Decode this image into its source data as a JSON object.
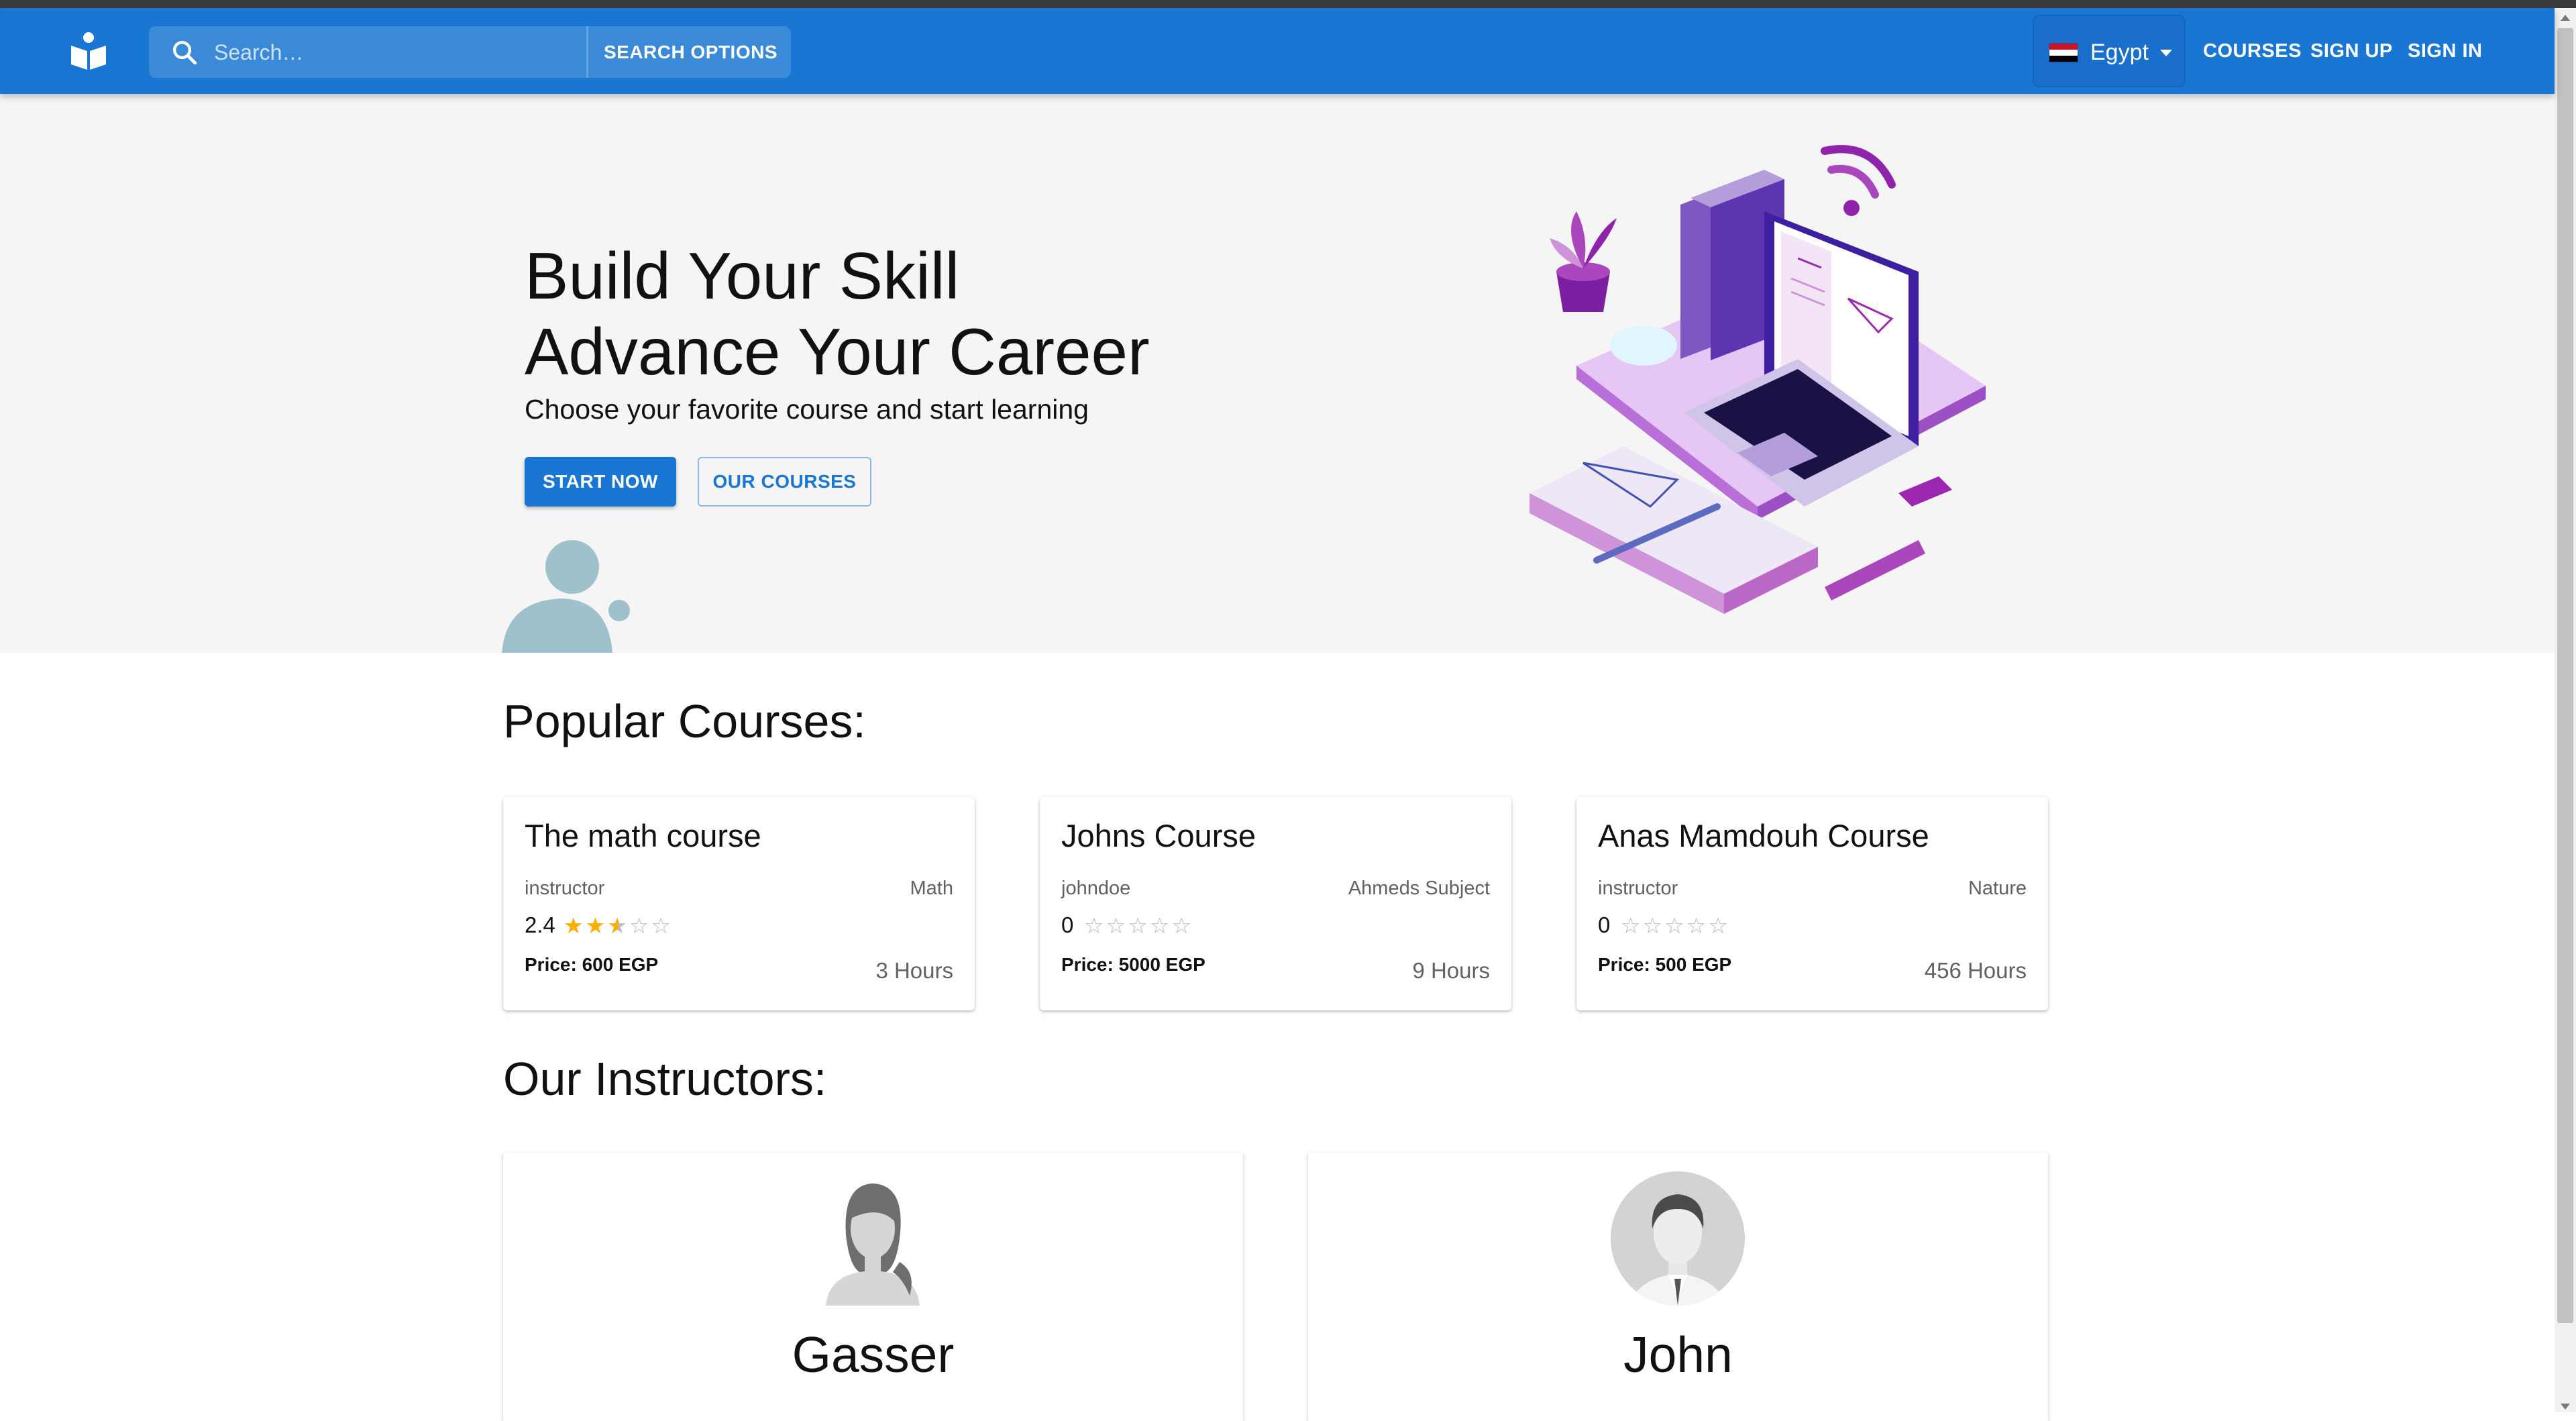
{
  "app": {
    "logo_icon": "book-reader-icon"
  },
  "search": {
    "placeholder": "Search…",
    "options_label": "SEARCH OPTIONS"
  },
  "country": {
    "label": "Egypt",
    "flag_icon": "egypt-flag-icon"
  },
  "nav": {
    "courses": "COURSES",
    "sign_up": "SIGN UP",
    "sign_in": "SIGN IN"
  },
  "hero": {
    "title_line1": "Build Your Skill",
    "title_line2": "Advance Your Career",
    "subtitle": "Choose your favorite course and start learning",
    "start_button": "START NOW",
    "courses_button": "OUR COURSES"
  },
  "popular": {
    "heading": "Popular Courses:",
    "courses": [
      {
        "title": "The math course",
        "instructor": "instructor",
        "subject": "Math",
        "rating": "2.4",
        "rating_value": 2.4,
        "price": "Price: 600 EGP",
        "hours": "3 Hours"
      },
      {
        "title": "Johns Course",
        "instructor": "johndoe",
        "subject": "Ahmeds Subject",
        "rating": "0",
        "rating_value": 0,
        "price": "Price: 5000 EGP",
        "hours": "9 Hours"
      },
      {
        "title": "Anas Mamdouh Course",
        "instructor": "instructor",
        "subject": "Nature",
        "rating": "0",
        "rating_value": 0,
        "price": "Price: 500 EGP",
        "hours": "456 Hours"
      }
    ]
  },
  "instructors": {
    "heading": "Our Instructors:",
    "list": [
      {
        "name": "Gasser",
        "avatar_icon": "female-avatar-icon"
      },
      {
        "name": "John",
        "avatar_icon": "male-avatar-icon"
      }
    ]
  },
  "colors": {
    "primary": "#1976d2",
    "star": "#faaf00",
    "hero_bg": "#f5f5f5"
  }
}
